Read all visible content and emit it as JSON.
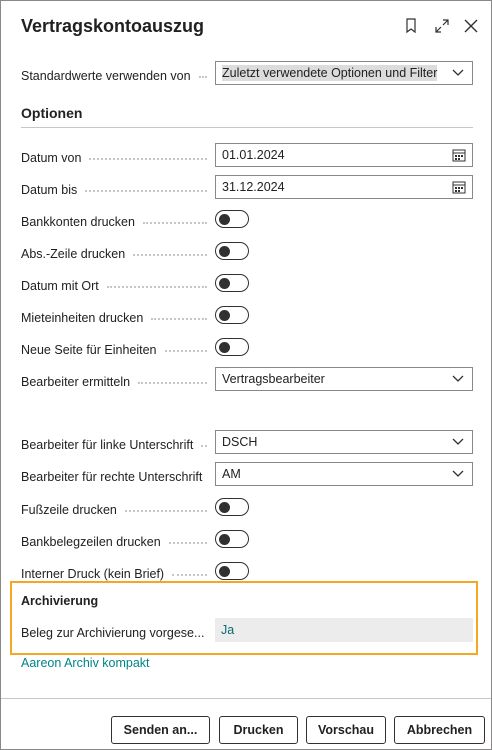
{
  "dialog": {
    "title": "Vertragskontoauszug",
    "header_icons": [
      "bookmark-icon",
      "expand-icon",
      "close-icon"
    ]
  },
  "defaults": {
    "label": "Standardwerte verwenden von",
    "value": "Zuletzt verwendete Optionen und Filter"
  },
  "options": {
    "heading": "Optionen",
    "date_from": {
      "label": "Datum von",
      "value": "01.01.2024"
    },
    "date_to": {
      "label": "Datum bis",
      "value": "31.12.2024"
    },
    "bank_accounts": {
      "label": "Bankkonten drucken",
      "on": false
    },
    "abs_line": {
      "label": "Abs.-Zeile drucken",
      "on": false
    },
    "date_place": {
      "label": "Datum mit Ort",
      "on": false
    },
    "rental_units": {
      "label": "Mieteinheiten drucken",
      "on": false
    },
    "new_page": {
      "label": "Neue Seite für Einheiten",
      "on": false
    },
    "editor": {
      "label": "Bearbeiter ermitteln",
      "value": "Vertragsbearbeiter"
    },
    "left_sig": {
      "label": "Bearbeiter für linke Unterschrift",
      "value": "DSCH"
    },
    "right_sig": {
      "label": "Bearbeiter für rechte Unterschrift",
      "value": "AM"
    },
    "footer": {
      "label": "Fußzeile drucken",
      "on": false
    },
    "bank_doc_lines": {
      "label": "Bankbelegzeilen drucken",
      "on": false
    },
    "internal_print": {
      "label": "Interner Druck (kein Brief)",
      "on": false
    }
  },
  "archive": {
    "heading": "Archivierung",
    "label": "Beleg zur Archivierung vorgese...",
    "value": "Ja",
    "link": "Aareon Archiv kompakt"
  },
  "buttons": {
    "send": "Senden an...",
    "print": "Drucken",
    "preview": "Vorschau",
    "cancel": "Abbrechen"
  },
  "colors": {
    "highlight_border": "#f5a623",
    "link": "#008489"
  }
}
